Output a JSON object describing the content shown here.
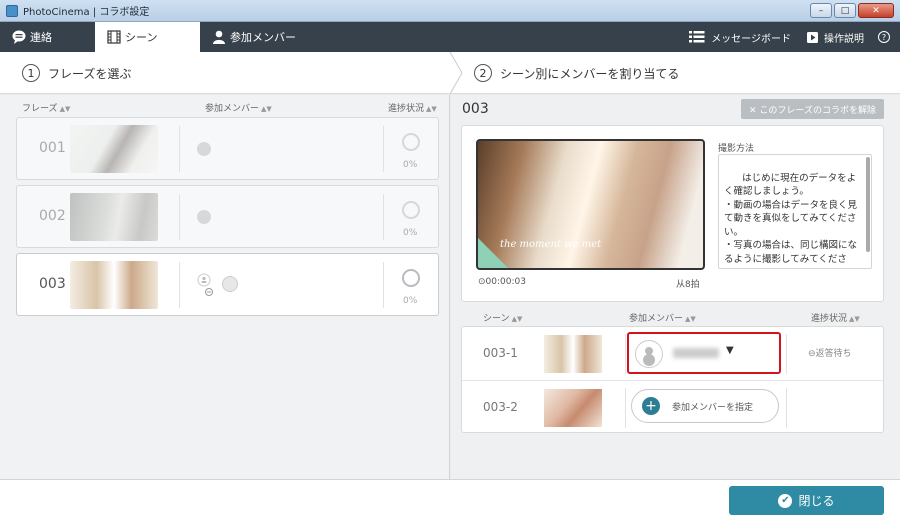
{
  "window": {
    "title": "PhotoCinema | コラボ設定",
    "min_label": "–",
    "max_label": "□",
    "close_label": "✕"
  },
  "nav": {
    "tabs": [
      {
        "label": "連絡",
        "icon": "chat-bubble-icon"
      },
      {
        "label": "シーン",
        "icon": "film-strip-icon"
      },
      {
        "label": "参加メンバー",
        "icon": "person-icon"
      }
    ],
    "message_board": "メッセージボード",
    "operation_help": "操作説明",
    "help_symbol": "?"
  },
  "steps": {
    "step1": {
      "num": "1",
      "label": "フレーズを選ぶ"
    },
    "step2": {
      "num": "2",
      "label": "シーン別にメンバーを割り当てる"
    }
  },
  "left": {
    "headers": {
      "phrase": "フレーズ",
      "members": "参加メンバー",
      "progress": "進捗状況"
    },
    "rows": [
      {
        "num": "001",
        "pct": "0%"
      },
      {
        "num": "002",
        "pct": "0%"
      },
      {
        "num": "003",
        "pct": "0%"
      }
    ]
  },
  "right": {
    "scene_number": "003",
    "unlink_button": "✕ このフレーズのコラボを解除",
    "video_caption": "the moment we met",
    "timecode": "⊙00:00:03",
    "beats": "从8拍",
    "method_label": "撮影方法",
    "method_text": "はじめに現在のデータをよく確認しましょう。\n・動画の場合はデータを良く見て動きを真似をしてみてください。\n・写真の場合は、同じ構図になるように撮影してみてください。\n※何度でもやり直しができますので、気軽にトライしてみてくださ",
    "headers": {
      "scene": "シーン",
      "members": "参加メンバー",
      "progress": "進捗状況"
    },
    "scenes": [
      {
        "id": "003-1",
        "status": "⊖返答待ち"
      },
      {
        "id": "003-2",
        "assign_label": "参加メンバーを指定"
      }
    ]
  },
  "footer": {
    "close_button": "閉じる"
  },
  "colors": {
    "nav_bg": "#37414b",
    "accent": "#2f8aa3",
    "highlight": "#d0141b"
  }
}
